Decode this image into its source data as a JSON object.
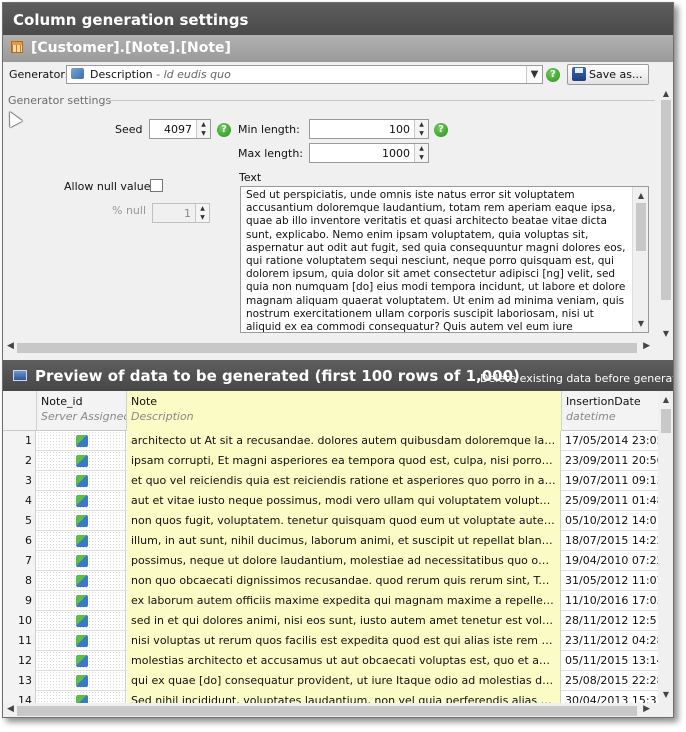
{
  "window": {
    "title": "Column generation settings",
    "column_path": "[Customer].[Note].[Note]"
  },
  "generator": {
    "label": "Generator:",
    "selected_name": "Description",
    "selected_desc": " - ld eudis quo",
    "save_as_label": "Save as...",
    "help_glyph": "?"
  },
  "settings": {
    "section_title": "Generator settings",
    "seed_label": "Seed",
    "seed_value": "4097",
    "min_length_label": "Min length:",
    "min_length_value": "100",
    "max_length_label": "Max length:",
    "max_length_value": "1000",
    "allow_null_label": "Allow null values",
    "allow_null_checked": false,
    "percent_null_label": "% null",
    "percent_null_value": "1",
    "text_label": "Text",
    "text_value": "Sed ut perspiciatis, unde omnis iste natus error sit voluptatem accusantium doloremque laudantium, totam rem aperiam eaque ipsa, quae ab illo inventore veritatis et quasi architecto beatae vitae dicta sunt, explicabo. Nemo enim ipsam voluptatem, quia voluptas sit, aspernatur aut odit aut fugit, sed quia consequuntur magni dolores eos, qui ratione voluptatem sequi nesciunt, neque porro quisquam est, qui dolorem ipsum, quia dolor sit amet consectetur adipisci [ng] velit, sed quia non numquam [do] eius modi tempora incidunt, ut labore et dolore magnam aliquam quaerat voluptatem. Ut enim ad minima veniam, quis nostrum exercitationem ullam corporis suscipit laboriosam, nisi ut aliquid ex ea commodi consequatur? Quis autem vel eum iure reprehenderit, qui in ea"
  },
  "preview": {
    "title": "Preview of data to be generated (first 100 rows of 1,000)",
    "delete_label": "Delete existing data before generation",
    "columns": [
      {
        "name": "Note_id",
        "type": "Server Assigned"
      },
      {
        "name": "Note",
        "type": "Description"
      },
      {
        "name": "InsertionDate",
        "type": "datetime"
      }
    ],
    "rows": [
      {
        "n": "1",
        "note": "architecto ut At sit a recusandae. dolores autem quibusdam doloremque laborum t...",
        "date": "17/05/2014 23:05:"
      },
      {
        "n": "2",
        "note": "ipsam corrupti, Et magni asperiores ea tempora quod est, culpa, nisi porro dolores sunt f...",
        "date": "23/09/2011 20:56:"
      },
      {
        "n": "3",
        "note": "et quo vel reiciendis quia est reiciendis ratione et asperiores quo porro in aliquid et...",
        "date": "19/07/2011 09:13:"
      },
      {
        "n": "4",
        "note": "aut et vitae iusto neque possimus, modi vero ullam qui voluptatem voluptatem. dol...",
        "date": "25/09/2011 01:48:"
      },
      {
        "n": "5",
        "note": "non quos fugit, voluptatem. tenetur quisquam quod eum ut voluptate autem nobis...",
        "date": "05/10/2012 14:01:"
      },
      {
        "n": "6",
        "note": "illum, in aut sunt, nihil ducimus, laborum animi, et suscipit ut repellat blanditiis sapi...",
        "date": "18/07/2015 14:22:"
      },
      {
        "n": "7",
        "note": "possimus, neque ut dolore laudantium, molestiae ad necessitatibus quo odio quia r...",
        "date": "19/04/2010 07:22:"
      },
      {
        "n": "8",
        "note": "non quo obcaecati dignissimos recusandae. quod rerum quis rerum sint, Temporibu...",
        "date": "31/05/2012 11:07:"
      },
      {
        "n": "9",
        "note": "ex laborum autem officiis maxime expedita qui magnam maxime a repellendus. eni...",
        "date": "11/10/2016 17:03:"
      },
      {
        "n": "10",
        "note": "sed in et qui dolores animi, nisi eos sunt, iusto autem amet tenetur est voluptas ve...",
        "date": "28/11/2012 12:51:"
      },
      {
        "n": "11",
        "note": "nisi voluptas ut rerum quos facilis est expedita quod est qui alias iste rem accusam...",
        "date": "23/11/2012 04:28:"
      },
      {
        "n": "12",
        "note": "molestias architecto et accusamus ut aut obcaecati voluptas est, quo et aut illum, e...",
        "date": "05/11/2015 13:14:"
      },
      {
        "n": "13",
        "note": "qui ex quae [do] consequatur provident, ut iure Itaque odio ad molestias dolorum s...",
        "date": "25/08/2015 22:28:"
      },
      {
        "n": "14",
        "note": "Sed nihil incididunt, voluptates laudantium, non vel quia perferendis alias voluptas r...",
        "date": "30/04/2013 15:31:"
      }
    ]
  },
  "colors": {
    "title_bar": "#4f4f4f",
    "sub_header": "#a3a3a3",
    "note_column": "#fbfbc6",
    "help_icon": "#3aa52a"
  }
}
